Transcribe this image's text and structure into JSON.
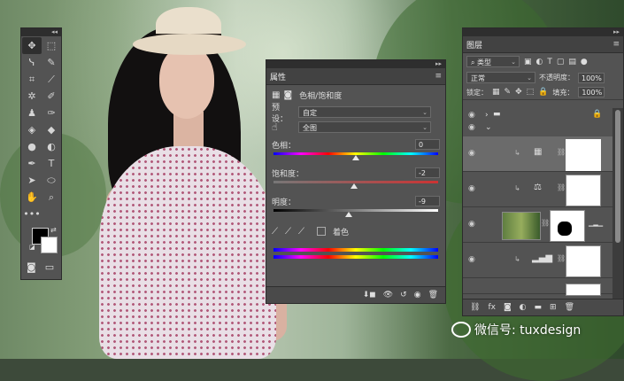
{
  "toolbox": {
    "tools": [
      {
        "name": "move-tool-icon",
        "glyph": "✥",
        "active": true
      },
      {
        "name": "marquee-tool-icon",
        "glyph": "⬚",
        "active": false
      },
      {
        "name": "lasso-tool-icon",
        "glyph": "ᓭ",
        "active": false
      },
      {
        "name": "quick-select-tool-icon",
        "glyph": "✎",
        "active": false
      },
      {
        "name": "crop-tool-icon",
        "glyph": "⌗",
        "active": false
      },
      {
        "name": "eyedropper-tool-icon",
        "glyph": "⟋",
        "active": false
      },
      {
        "name": "healing-brush-tool-icon",
        "glyph": "✲",
        "active": false
      },
      {
        "name": "brush-tool-icon",
        "glyph": "✐",
        "active": false
      },
      {
        "name": "stamp-tool-icon",
        "glyph": "♟",
        "active": false
      },
      {
        "name": "history-brush-tool-icon",
        "glyph": "✑",
        "active": false
      },
      {
        "name": "eraser-tool-icon",
        "glyph": "◈",
        "active": false
      },
      {
        "name": "paint-bucket-tool-icon",
        "glyph": "◆",
        "active": false
      },
      {
        "name": "blur-tool-icon",
        "glyph": "●",
        "active": false
      },
      {
        "name": "dodge-tool-icon",
        "glyph": "◐",
        "active": false
      },
      {
        "name": "pen-tool-icon",
        "glyph": "✒",
        "active": false
      },
      {
        "name": "type-tool-icon",
        "glyph": "T",
        "active": false
      },
      {
        "name": "path-select-tool-icon",
        "glyph": "➤",
        "active": false
      },
      {
        "name": "shape-tool-icon",
        "glyph": "⬭",
        "active": false
      },
      {
        "name": "hand-tool-icon",
        "glyph": "✋",
        "active": false
      },
      {
        "name": "zoom-tool-icon",
        "glyph": "⌕",
        "active": false
      },
      {
        "name": "more-tools-icon",
        "glyph": "•••",
        "active": false
      },
      {
        "name": "empty-slot",
        "glyph": "",
        "active": false
      }
    ],
    "colors": {
      "foreground": "#000000",
      "background": "#ffffff"
    },
    "bottom": {
      "quick_mask": "◙",
      "screen_mode": "▭"
    }
  },
  "properties": {
    "tab": "属性",
    "adjustment_title": "色相/饱和度",
    "preset_label": "预设：",
    "preset_value": "自定",
    "channel_value": "全图",
    "hue_label": "色相：",
    "hue_value": "0",
    "hue_fraction": 0.5,
    "saturation_label": "饱和度：",
    "saturation_value": "-2",
    "saturation_fraction": 0.49,
    "lightness_label": "明度：",
    "lightness_value": "-9",
    "lightness_fraction": 0.455,
    "colorize_label": "着色"
  },
  "layers": {
    "tab": "图层",
    "filter_label": "类型",
    "blend_mode": "正常",
    "opacity_label": "不透明度：",
    "opacity_value": "100%",
    "lock_label": "锁定：",
    "fill_label": "填充：",
    "fill_value": "100%"
  },
  "watermark": {
    "text": "微信号: tuxdesign"
  }
}
